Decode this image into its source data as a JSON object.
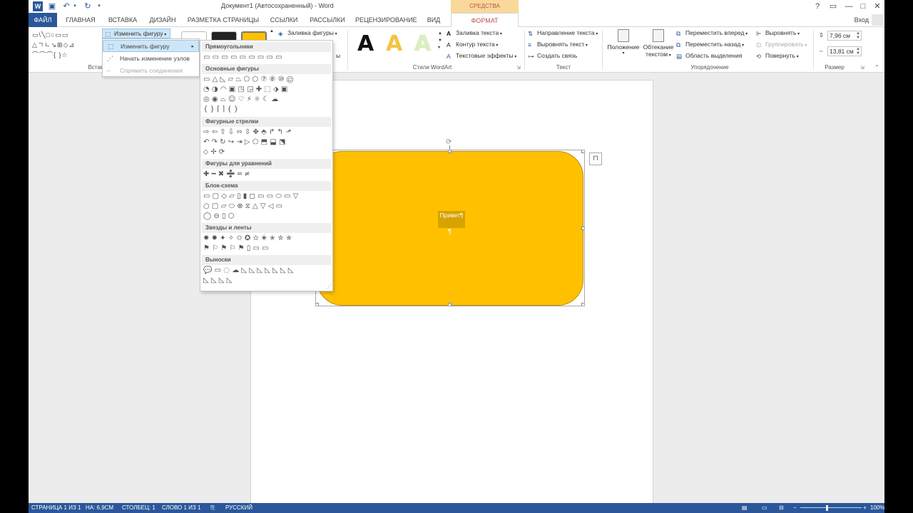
{
  "window": {
    "title": "Документ1 (Автосохраненный) - Word",
    "context_tab": "СРЕДСТВА РИСОВАНИЯ",
    "help": "?",
    "controls": [
      "▭",
      "—",
      "□",
      "✕"
    ],
    "login": "Вход"
  },
  "tabs": [
    {
      "label": "ФАЙЛ"
    },
    {
      "label": "ГЛАВНАЯ"
    },
    {
      "label": "ВСТАВКА"
    },
    {
      "label": "ДИЗАЙН"
    },
    {
      "label": "РАЗМЕТКА СТРАНИЦЫ"
    },
    {
      "label": "ССЫЛКИ"
    },
    {
      "label": "РАССЫЛКИ"
    },
    {
      "label": "РЕЦЕНЗИРОВАНИЕ"
    },
    {
      "label": "ВИД"
    },
    {
      "label": "ФОРМАТ"
    }
  ],
  "ribbon": {
    "insert_shapes": {
      "group_label": "Вставк",
      "edit_shape": "Изменить фигуру",
      "shape_rows": [
        "▭\\╲□○▭▭",
        "△ㄱㄴ↘⊞◇⊿",
        "⌒⌒⌒{ }☆"
      ]
    },
    "shape_styles": {
      "fill": "Заливка фигуры",
      "more": "ы"
    },
    "wordart": {
      "group_label": "Стили WordArt",
      "letters": [
        "A",
        "A",
        "A"
      ],
      "text_fill": "Заливка текста",
      "text_outline": "Контур текста",
      "text_effects": "Текстовые эффекты"
    },
    "text": {
      "group_label": "Текст",
      "direction": "Направление текста",
      "align": "Выровнять текст",
      "link": "Создать связь"
    },
    "arrange": {
      "group_label": "Упорядочение",
      "position": "Положение",
      "wrap_1": "Обтекание",
      "wrap_2": "текстом",
      "forward": "Переместить вперед",
      "backward": "Переместить назад",
      "selection_pane": "Область выделения",
      "align": "Выровнять",
      "group": "Группировать",
      "rotate": "Повернуть"
    },
    "size": {
      "group_label": "Размер",
      "height": "7,96 см",
      "width": "13,81 см"
    }
  },
  "edit_shape_menu": {
    "items": [
      {
        "label": "Изменить фигуру"
      },
      {
        "label": "Начать изменение узлов"
      },
      {
        "label": "Спрямить соединения"
      }
    ]
  },
  "shapes_gallery": {
    "sections": [
      {
        "title": "Прямоугольники",
        "rows": [
          "▭▭▭▭▭▭▭▭▭"
        ]
      },
      {
        "title": "Основные фигуры",
        "rows": [
          "▭△◺▱⏢⬠⬡⑦⑧⑩⑫",
          "◔◑◠▣◳◲✚⬚⬗▣",
          "◎◉⌓☺♡⚡☼☾☁",
          "{}⌈⌉{}"
        ]
      },
      {
        "title": "Фигурные стрелки",
        "rows": [
          "⇨⇦⇧⇩⬄⇳✥⬘↱↰⬏",
          "↶↷↻↪⇥▷⬠⬒⬓⬔",
          "⬦✢⟳"
        ]
      },
      {
        "title": "Фигуры для уравнений",
        "rows": [
          "✚━✖➗═≠"
        ]
      },
      {
        "title": "Блок-схема",
        "rows": [
          "▭▢◇▱▯▮◻▭▭⬭▭▽",
          "○▢▱⬭⊗⧖△▽◁▭",
          "◯⊖▯⬡"
        ]
      },
      {
        "title": "Звезды и ленты",
        "rows": [
          "✸✹✦✧✩✪✫✬✭✮✯",
          "⚑⚐⚑⚐⚑▯▭▭"
        ]
      },
      {
        "title": "Выноски",
        "rows": [
          "💬▭◌☁◺◺◺◺◺◺◺",
          "◺◺◺◺"
        ]
      }
    ]
  },
  "document": {
    "shape_text": "Привет¶",
    "pilcrow": "¶",
    "shape_color": "#ffc000"
  },
  "statusbar": {
    "page": "СТРАНИЦА 1 ИЗ 1",
    "position": "НА: 6,9СМ",
    "column": "СТОЛБЕЦ: 1",
    "words": "СЛОВО 1 ИЗ 1",
    "language": "РУССКИЙ",
    "zoom": "100%"
  },
  "colors": {
    "brand_blue": "#2b579a",
    "context_tab": "#f8d99a",
    "shape_fill": "#ffc000"
  }
}
